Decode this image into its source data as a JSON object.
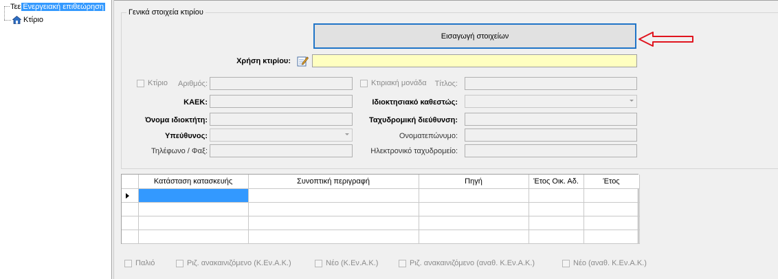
{
  "tree": {
    "root_prefix": "Τεε",
    "root_selected_label": "Ενεργειακή επιθεώρηση",
    "child_label": "Κτίριο"
  },
  "group": {
    "title": "Γενικά στοιχεία κτιρίου"
  },
  "main": {
    "import_button_label": "Εισαγωγή στοιχείων",
    "usage_label": "Χρήση κτιρίου:",
    "usage_value": "",
    "building_checkbox_label": "Κτίριο",
    "number_label": "Αριθμός:",
    "unit_checkbox_label": "Κτιριακή μονάδα",
    "title_label": "Τίτλος:",
    "kaek_label": "ΚΑΕΚ:",
    "ownership_label": "Ιδιοκτησιακό καθεστώς:",
    "owner_name_label": "Όνομα ιδιοκτήτη:",
    "postal_address_label": "Ταχυδρομική διεύθυνση:",
    "responsible_label": "Υπεύθυνος:",
    "fullname_label": "Ονοματεπώνυμο:",
    "phone_fax_label": "Τηλέφωνο / Φαξ:",
    "email_label": "Ηλεκτρονικό ταχυδρομείο:"
  },
  "grid": {
    "columns": [
      "Κατάσταση κατασκευής",
      "Συνοπτική περιγραφή",
      "Πηγή",
      "Έτος Οικ. Αδ.",
      "Έτος"
    ]
  },
  "checkboxes": [
    "Παλιό",
    "Ριζ. ανακαινιζόμενο (Κ.Εν.Α.Κ.)",
    "Νέο (Κ.Εν.Α.Κ.)",
    "Ριζ. ανακαινιζόμενο (αναθ. Κ.Εν.Α.Κ.)",
    "Νέο (αναθ. Κ.Εν.Α.Κ.)"
  ],
  "colors": {
    "selection": "#3399ff",
    "button_border": "#1f74c7",
    "arrow": "#e0141e",
    "usage_field": "#ffffc0"
  }
}
